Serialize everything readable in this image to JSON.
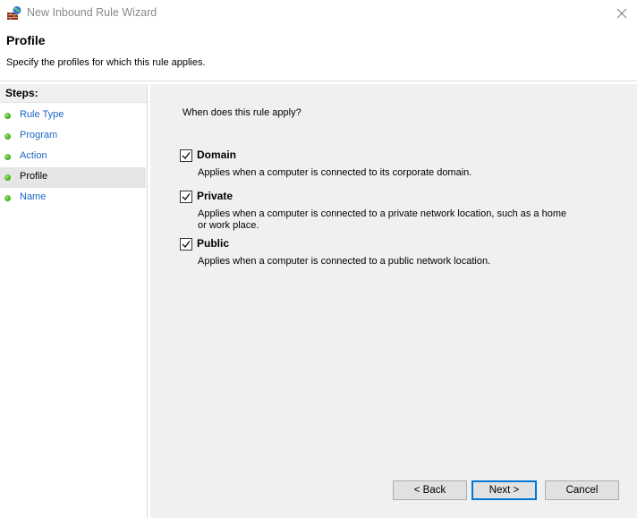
{
  "window": {
    "title": "New Inbound Rule Wizard"
  },
  "header": {
    "title": "Profile",
    "subtitle": "Specify the profiles for which this rule applies."
  },
  "steps": {
    "heading": "Steps:",
    "items": [
      {
        "label": "Rule Type",
        "active": false
      },
      {
        "label": "Program",
        "active": false
      },
      {
        "label": "Action",
        "active": false
      },
      {
        "label": "Profile",
        "active": true
      },
      {
        "label": "Name",
        "active": false
      }
    ]
  },
  "main": {
    "question": "When does this rule apply?",
    "options": [
      {
        "label": "Domain",
        "checked": true,
        "description": "Applies when a computer is connected to its corporate domain."
      },
      {
        "label": "Private",
        "checked": true,
        "description": "Applies when a computer is connected to a private network location, such as a home or work place."
      },
      {
        "label": "Public",
        "checked": true,
        "description": "Applies when a computer is connected to a public network location."
      }
    ]
  },
  "buttons": {
    "back": "< Back",
    "next": "Next >",
    "cancel": "Cancel"
  },
  "colors": {
    "link": "#1c67c7",
    "panel_bg": "#f0f0f0",
    "default_button_border": "#0078d7",
    "step_dot": "#3aa61c"
  },
  "icons": {
    "app": "firewall-icon",
    "close": "close-icon",
    "step": "green-dot-icon",
    "check": "checkmark-icon"
  }
}
